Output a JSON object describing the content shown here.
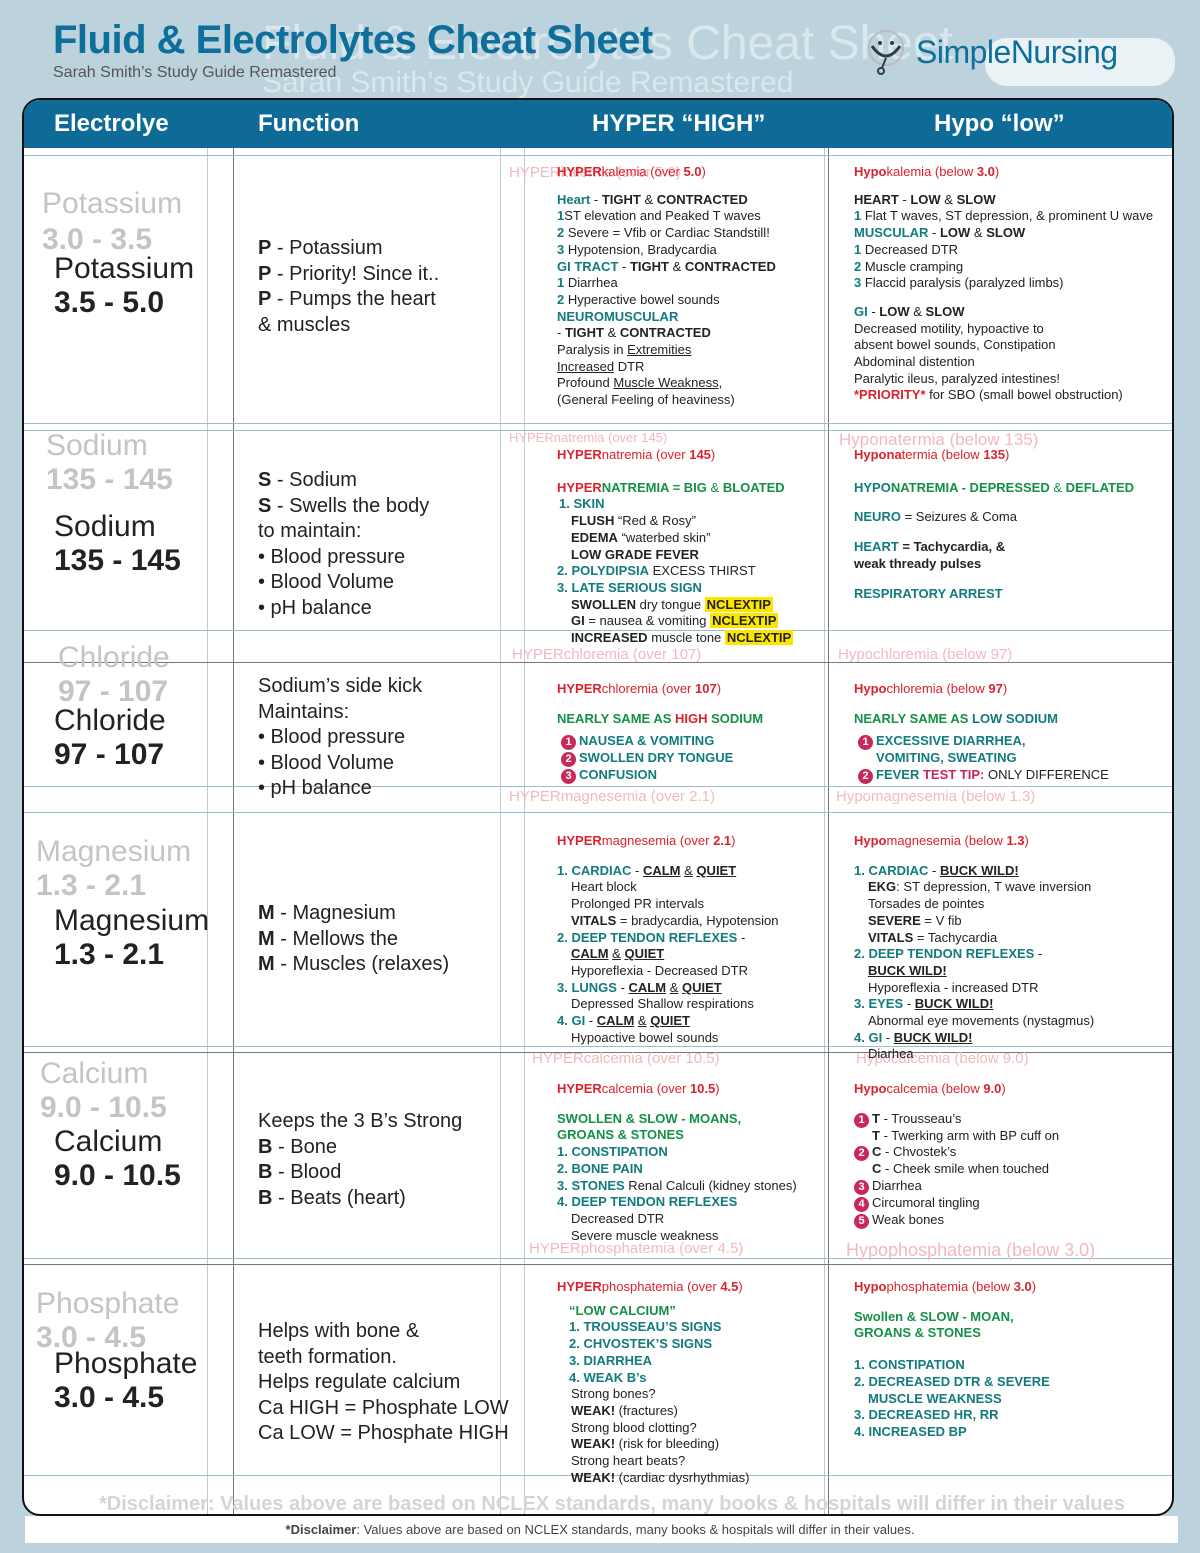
{
  "title": "Fluid & Electrolytes Cheat Sheet",
  "subtitle": "Sarah Smith’s Study Guide Remastered",
  "brand": "SimpleNursing",
  "colors": {
    "brand_blue": "#0e6b98",
    "red": "#d9232d",
    "teal": "#127b7e",
    "green": "#149046",
    "highlight": "#fce600"
  },
  "header": {
    "electrolyte": "Electrolye",
    "function": "Function",
    "hyper": "HYPER “HIGH”",
    "hypo": "Hypo “low”"
  },
  "rows": [
    {
      "name": "Potassium",
      "range": "3.5 - 5.0",
      "ghost_range": "3.0 - 3.5",
      "function": [
        "P",
        " - Potassium",
        "P",
        " - Priority! Since it..",
        "P",
        " - Pumps the heart",
        "& muscles"
      ],
      "hyper_title": [
        "HYPER",
        "kalemia (over ",
        "5.0",
        ")"
      ],
      "hypo_title": [
        "Hypo",
        "kalemia (below ",
        "3.0",
        ")"
      ]
    },
    {
      "name": "Sodium",
      "range": "135 - 145",
      "function": [
        "S",
        " - Sodium",
        "S",
        " - Swells the body",
        "to maintain:",
        "• Blood pressure",
        "• Blood Volume",
        "• pH balance"
      ],
      "hyper_title": [
        "HYPER",
        "natremia (over ",
        "145",
        ")"
      ],
      "hypo_title": [
        "Hypona",
        "termia (below ",
        "135",
        ")"
      ]
    },
    {
      "name": "Chloride",
      "range": "97 - 107",
      "function": [
        "Sodium’s side kick",
        "Maintains:",
        "• Blood pressure",
        "• Blood Volume",
        "• pH balance"
      ],
      "hyper_title": [
        "HYPER",
        "chloremia (over ",
        "107",
        ")"
      ],
      "hypo_title": [
        "Hypo",
        "chloremia (below ",
        "97",
        ")"
      ]
    },
    {
      "name": "Magnesium",
      "range": "1.3 - 2.1",
      "function": [
        "M",
        " - Magnesium",
        "M",
        " - Mellows the",
        "M",
        " - Muscles (relaxes)"
      ],
      "hyper_title": [
        "HYPER",
        "magnesemia (over ",
        "2.1",
        ")"
      ],
      "hypo_title": [
        "Hypo",
        "magnesemia (below ",
        "1.3",
        ")"
      ]
    },
    {
      "name": "Calcium",
      "range": "9.0 - 10.5",
      "function": [
        "Keeps the 3 B’s Strong",
        "B",
        " - Bone",
        "B",
        " - Blood",
        "B",
        " - Beats (heart)"
      ],
      "hyper_title": [
        "HYPER",
        "calcemia (over ",
        "10.5",
        ")"
      ],
      "hypo_title": [
        "Hypo",
        "calcemia (below ",
        "9.0",
        ")"
      ]
    },
    {
      "name": "Phosphate",
      "range": "3.0 - 4.5",
      "function": [
        "Helps with bone &",
        "teeth formation.",
        "Helps regulate calcium",
        "Ca HIGH = Phosphate LOW",
        "Ca LOW = Phosphate HIGH"
      ],
      "hyper_title": [
        "HYPER",
        "phosphatemia (over ",
        "4.5",
        ")"
      ],
      "hypo_title": [
        "Hypo",
        "phosphatemia (below ",
        "3.0",
        ")"
      ]
    }
  ],
  "k": {
    "hyper": {
      "heart": "Heart",
      "tight": "TIGHT",
      "amp": "&",
      "contracted": "CONTRACTED",
      "l1n": "1",
      "l1": "ST elevation and Peaked T waves",
      "l2n": "2",
      "l2": " Severe = Vfib or Cardiac Standstill!",
      "l3n": "3",
      "l3": " Hypotension, Bradycardia",
      "gi": "GI TRACT",
      "g1n": "1",
      "g1": " Diarrhea",
      "g2n": "2",
      "g2": " Hyperactive bowel sounds",
      "neuro": "NEUROMUSCULAR",
      "n1a": "Paralysis in ",
      "n1b": "Extremities",
      "n2a": "Increased",
      "n2b": " DTR",
      "n3a": "Profound ",
      "n3b": "Muscle Weakness",
      "n4": "(General Feeling of heaviness)"
    },
    "hypo": {
      "heart": "HEART",
      "low": "LOW",
      "amp": "&",
      "slow": "SLOW",
      "h1n": "1",
      "h1": " Flat T waves, ST depression, & prominent U wave",
      "musc": "MUSCULAR",
      "m1n": "1",
      "m1": " Decreased DTR",
      "m2n": "2",
      "m2": " Muscle cramping",
      "m3n": "3",
      "m3": " Flaccid paralysis (paralyzed limbs)",
      "gi": "GI",
      "g1": "Decreased motility, hypoactive to",
      "g2": "absent bowel sounds, Constipation",
      "g3": "Abdominal distention",
      "g4": "Paralytic ileus, paralyzed intestines!",
      "priority": "*PRIORITY*",
      "g5": " for SBO (small bowel obstruction)"
    }
  },
  "na": {
    "hyper": {
      "h1": "HYPER",
      "h2": "NATREMIA = BIG",
      "h3": "&",
      "h4": "BLOATED",
      "skin": "1. SKIN",
      "flush": "FLUSH",
      "flush_t": " “Red & Rosy”",
      "edema": "EDEMA",
      "edema_t": " “waterbed skin”",
      "fever": "LOW GRADE FEVER",
      "poly": "2. POLYDIPSIA",
      "poly_t": " EXCESS THIRST",
      "late": "3. LATE SERIOUS SIGN",
      "sw": "SWOLLEN",
      "sw_t": " dry tongue ",
      "gi": "GI",
      "gi_t": " = nausea & vomiting ",
      "inc": "INCREASED",
      "inc_t": " muscle tone ",
      "tip": "NCLEXTIP"
    },
    "hypo": {
      "h1": "HYPO",
      "h2": "NATREMIA - DEPRESSED",
      "h3": "&",
      "h4": "DEFLATED",
      "neuro": "NEURO",
      "neuro_t": " = Seizures & Coma",
      "heart": "HEART",
      "heart_t": " = Tachycardia, &",
      "heart_t2": "weak thready pulses",
      "resp": "RESPIRATORY ARREST"
    }
  },
  "cl": {
    "hyper": {
      "s1": "NEARLY SAME AS ",
      "s2": "HIGH",
      "s3": " SODIUM",
      "items": [
        {
          "n": "1",
          "t": "NAUSEA & VOMITING"
        },
        {
          "n": "2",
          "t": "SWOLLEN DRY TONGUE"
        },
        {
          "n": "3",
          "t": "CONFUSION"
        }
      ]
    },
    "hypo": {
      "s1": "NEARLY SAME AS ",
      "s2": "LOW SODIUM",
      "i1n": "1",
      "i1a": "EXCESSIVE DIARRHEA,",
      "i1b": "VOMITING, SWEATING",
      "i2n": "2",
      "i2a": "FEVER ",
      "i2b": "TEST TIP:",
      "i2c": " ONLY DIFFERENCE"
    }
  },
  "mg": {
    "hyper": {
      "c1": "1. CARDIAC",
      "calm": "CALM",
      "amp": "&",
      "quiet": "QUIET",
      "dash": " - ",
      "c1a": "Heart block",
      "c1b": "Prolonged PR intervals",
      "vit": "VITALS",
      "vit_t": " = bradycardia, Hypotension",
      "c2": "2. DEEP TENDON REFLEXES",
      "c2a": "Hyporeflexia - Decreased DTR",
      "c3": "3. LUNGS",
      "c3a": "Depressed Shallow respirations",
      "c4": "4. GI",
      "c4a": "Hypoactive bowel sounds"
    },
    "hypo": {
      "c1": "1. CARDIAC",
      "buck": "BUCK WILD!",
      "dash": " - ",
      "ekg": "EKG",
      "ekg_t": ": ST depression, T wave inversion",
      "tors": "Torsades de pointes",
      "sev": "SEVERE",
      "sev_t": " = V fib",
      "vit": "VITALS",
      "vit_t": " = Tachycardia",
      "c2": "2. DEEP TENDON REFLEXES",
      "c2a": "Hyporeflexia - increased DTR",
      "c3": "3. EYES",
      "c3a": "Abnormal eye movements (nystagmus)",
      "c4": "4. GI",
      "c4a": "Diarhea"
    }
  },
  "ca": {
    "hyper": {
      "s1": "SWOLLEN & SLOW - MOANS,",
      "s2": "GROANS & STONES",
      "i1": "1. CONSTIPATION",
      "i2": "2. BONE PAIN",
      "i3": "3. STONES",
      "i3t": " Renal Calculi (kidney stones)",
      "i4": "4. DEEP TENDON REFLEXES",
      "i4a": "Decreased DTR",
      "i4b": "Severe muscle weakness"
    },
    "hypo": {
      "items": [
        {
          "n": "1",
          "b": "T",
          "t": " - Trousseau’s"
        },
        {
          "n": "",
          "b": "T",
          "t": " - Twerking arm with BP cuff on"
        },
        {
          "n": "2",
          "b": "C",
          "t": " - Chvostek’s"
        },
        {
          "n": "",
          "b": "C",
          "t": " - Cheek smile when touched"
        },
        {
          "n": "3",
          "b": "",
          "t": "Diarrhea"
        },
        {
          "n": "4",
          "b": "",
          "t": "Circumoral tingling"
        },
        {
          "n": "5",
          "b": "",
          "t": "Weak bones"
        }
      ]
    }
  },
  "ph": {
    "hyper": {
      "low": "“LOW CALCIUM”",
      "i1": "1. TROUSSEAU’S SIGNS",
      "i2": "2. CHVOSTEK’S SIGNS",
      "i3": "3. DIARRHEA",
      "i4": "4. WEAK B’s",
      "w1": "Strong bones?",
      "weak": "WEAK!",
      "w1t": " (fractures)",
      "w2": "Strong blood clotting?",
      "w2t": " (risk for bleeding)",
      "w3": "Strong heart beats?",
      "w3t": " (cardiac dysrhythmias)"
    },
    "hypo": {
      "s1": "Swollen & SLOW - MOAN,",
      "s2": "GROANS & STONES",
      "i1": "1. CONSTIPATION",
      "i2": "2. DECREASED DTR & SEVERE",
      "i2b": "MUSCLE WEAKNESS",
      "i3": "3. DECREASED HR, RR",
      "i4": "4. INCREASED BP"
    }
  },
  "disclaimer": {
    "label": "*Disclaimer",
    "text": ": Values above are based on NCLEX standards, many books & hospitals will differ in their values."
  },
  "disclaimer_ghost": "*Disclaimer: Values above are based on NCLEX standards, many books & hospitals will differ in their values"
}
